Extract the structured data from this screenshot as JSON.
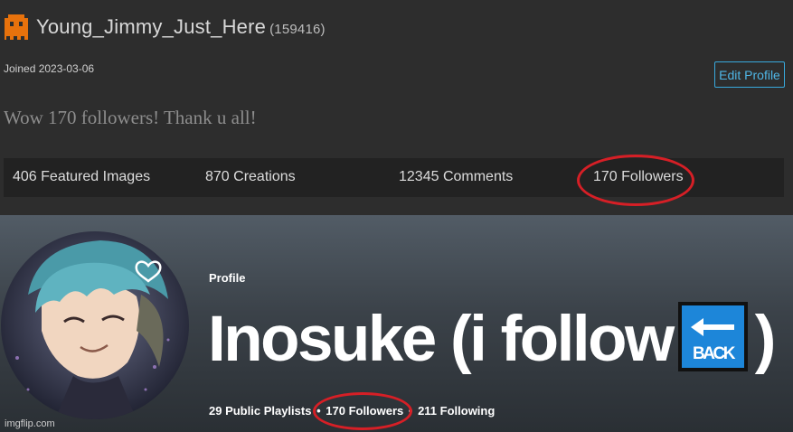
{
  "top": {
    "username": "Young_Jimmy_Just_Here",
    "points": "(159416)",
    "joined": "Joined 2023-03-06",
    "edit_profile": "Edit Profile",
    "bio": "Wow 170 followers! Thank u all!",
    "stats": {
      "featured": "406 Featured Images",
      "creations": "870 Creations",
      "comments": "12345 Comments",
      "followers": "170 Followers"
    },
    "colors": {
      "accent": "#38a9dd",
      "icon": "#e8720c"
    }
  },
  "spotify": {
    "label": "Profile",
    "name_part1": "Inosuke (i follow",
    "name_part2": ")",
    "back_emoji_text": "BACK",
    "playlists": "29 Public Playlists",
    "followers": "170 Followers",
    "following": "211 Following",
    "separator": "•"
  },
  "annotation": {
    "circle_color": "#d61f26"
  },
  "watermark": "imgflip.com"
}
